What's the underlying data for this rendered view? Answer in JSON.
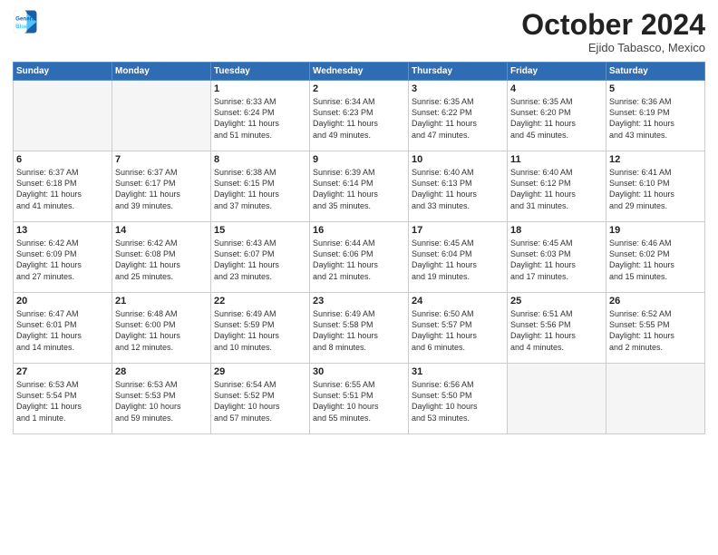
{
  "header": {
    "logo_line1": "General",
    "logo_line2": "Blue",
    "month": "October 2024",
    "location": "Ejido Tabasco, Mexico"
  },
  "days_of_week": [
    "Sunday",
    "Monday",
    "Tuesday",
    "Wednesday",
    "Thursday",
    "Friday",
    "Saturday"
  ],
  "weeks": [
    [
      {
        "day": "",
        "info": ""
      },
      {
        "day": "",
        "info": ""
      },
      {
        "day": "1",
        "info": "Sunrise: 6:33 AM\nSunset: 6:24 PM\nDaylight: 11 hours\nand 51 minutes."
      },
      {
        "day": "2",
        "info": "Sunrise: 6:34 AM\nSunset: 6:23 PM\nDaylight: 11 hours\nand 49 minutes."
      },
      {
        "day": "3",
        "info": "Sunrise: 6:35 AM\nSunset: 6:22 PM\nDaylight: 11 hours\nand 47 minutes."
      },
      {
        "day": "4",
        "info": "Sunrise: 6:35 AM\nSunset: 6:20 PM\nDaylight: 11 hours\nand 45 minutes."
      },
      {
        "day": "5",
        "info": "Sunrise: 6:36 AM\nSunset: 6:19 PM\nDaylight: 11 hours\nand 43 minutes."
      }
    ],
    [
      {
        "day": "6",
        "info": "Sunrise: 6:37 AM\nSunset: 6:18 PM\nDaylight: 11 hours\nand 41 minutes."
      },
      {
        "day": "7",
        "info": "Sunrise: 6:37 AM\nSunset: 6:17 PM\nDaylight: 11 hours\nand 39 minutes."
      },
      {
        "day": "8",
        "info": "Sunrise: 6:38 AM\nSunset: 6:15 PM\nDaylight: 11 hours\nand 37 minutes."
      },
      {
        "day": "9",
        "info": "Sunrise: 6:39 AM\nSunset: 6:14 PM\nDaylight: 11 hours\nand 35 minutes."
      },
      {
        "day": "10",
        "info": "Sunrise: 6:40 AM\nSunset: 6:13 PM\nDaylight: 11 hours\nand 33 minutes."
      },
      {
        "day": "11",
        "info": "Sunrise: 6:40 AM\nSunset: 6:12 PM\nDaylight: 11 hours\nand 31 minutes."
      },
      {
        "day": "12",
        "info": "Sunrise: 6:41 AM\nSunset: 6:10 PM\nDaylight: 11 hours\nand 29 minutes."
      }
    ],
    [
      {
        "day": "13",
        "info": "Sunrise: 6:42 AM\nSunset: 6:09 PM\nDaylight: 11 hours\nand 27 minutes."
      },
      {
        "day": "14",
        "info": "Sunrise: 6:42 AM\nSunset: 6:08 PM\nDaylight: 11 hours\nand 25 minutes."
      },
      {
        "day": "15",
        "info": "Sunrise: 6:43 AM\nSunset: 6:07 PM\nDaylight: 11 hours\nand 23 minutes."
      },
      {
        "day": "16",
        "info": "Sunrise: 6:44 AM\nSunset: 6:06 PM\nDaylight: 11 hours\nand 21 minutes."
      },
      {
        "day": "17",
        "info": "Sunrise: 6:45 AM\nSunset: 6:04 PM\nDaylight: 11 hours\nand 19 minutes."
      },
      {
        "day": "18",
        "info": "Sunrise: 6:45 AM\nSunset: 6:03 PM\nDaylight: 11 hours\nand 17 minutes."
      },
      {
        "day": "19",
        "info": "Sunrise: 6:46 AM\nSunset: 6:02 PM\nDaylight: 11 hours\nand 15 minutes."
      }
    ],
    [
      {
        "day": "20",
        "info": "Sunrise: 6:47 AM\nSunset: 6:01 PM\nDaylight: 11 hours\nand 14 minutes."
      },
      {
        "day": "21",
        "info": "Sunrise: 6:48 AM\nSunset: 6:00 PM\nDaylight: 11 hours\nand 12 minutes."
      },
      {
        "day": "22",
        "info": "Sunrise: 6:49 AM\nSunset: 5:59 PM\nDaylight: 11 hours\nand 10 minutes."
      },
      {
        "day": "23",
        "info": "Sunrise: 6:49 AM\nSunset: 5:58 PM\nDaylight: 11 hours\nand 8 minutes."
      },
      {
        "day": "24",
        "info": "Sunrise: 6:50 AM\nSunset: 5:57 PM\nDaylight: 11 hours\nand 6 minutes."
      },
      {
        "day": "25",
        "info": "Sunrise: 6:51 AM\nSunset: 5:56 PM\nDaylight: 11 hours\nand 4 minutes."
      },
      {
        "day": "26",
        "info": "Sunrise: 6:52 AM\nSunset: 5:55 PM\nDaylight: 11 hours\nand 2 minutes."
      }
    ],
    [
      {
        "day": "27",
        "info": "Sunrise: 6:53 AM\nSunset: 5:54 PM\nDaylight: 11 hours\nand 1 minute."
      },
      {
        "day": "28",
        "info": "Sunrise: 6:53 AM\nSunset: 5:53 PM\nDaylight: 10 hours\nand 59 minutes."
      },
      {
        "day": "29",
        "info": "Sunrise: 6:54 AM\nSunset: 5:52 PM\nDaylight: 10 hours\nand 57 minutes."
      },
      {
        "day": "30",
        "info": "Sunrise: 6:55 AM\nSunset: 5:51 PM\nDaylight: 10 hours\nand 55 minutes."
      },
      {
        "day": "31",
        "info": "Sunrise: 6:56 AM\nSunset: 5:50 PM\nDaylight: 10 hours\nand 53 minutes."
      },
      {
        "day": "",
        "info": ""
      },
      {
        "day": "",
        "info": ""
      }
    ]
  ]
}
